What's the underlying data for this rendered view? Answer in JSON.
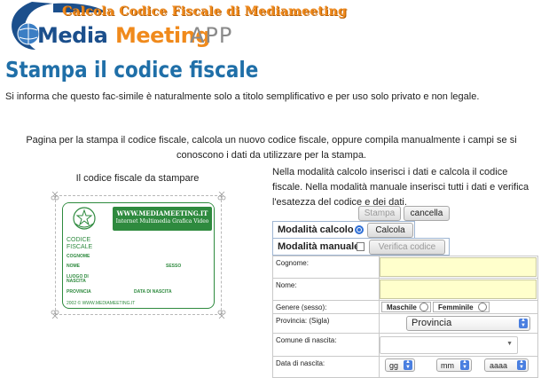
{
  "banner": {
    "title": "Calcola Codice Fiscale di Mediameeting",
    "logo_media": "Media",
    "logo_meeting": "Meeting",
    "logo_app": "APP"
  },
  "page": {
    "title": "Stampa il codice fiscale",
    "intro": "Si informa che questo fac-simile è naturalmente solo a titolo semplificativo e per uso solo privato e non legale.",
    "center_text": "Pagina per la stampa il codice fiscale, calcola un nuovo codice fiscale, oppure compila manualmente i campi se si conoscono i dati da utilizzare per la stampa."
  },
  "card": {
    "caption": "Il codice fiscale da stampare",
    "site": "WWW.MEDIAMEETING.IT",
    "subtitle": "Internet Multimedia Grafica Video",
    "cf_line1": "CODICE",
    "cf_line2": "FISCALE",
    "labels": {
      "cognome": "COGNOME",
      "nome": "NOME",
      "sesso": "SESSO",
      "luogo1": "LUOGO DI",
      "luogo2": "NASCITA",
      "provincia": "PROVINCIA",
      "data": "DATA DI NASCITA"
    },
    "footer": "2002 © WWW.MEDIAMEETING.IT",
    "colors": {
      "green": "#2e8a3e"
    }
  },
  "right": {
    "text": "Nella modalità calcolo inserisci i dati e calcola il codice fiscale. Nella modalità manuale inserisci tutti i dati e verifica l'esatezza del codice e dei dati.",
    "stampa_label": "Stampa",
    "cancella_label": "cancella",
    "mode_calcolo_label": "Modalità calcolo",
    "calcola_label": "Calcola",
    "mode_manuale_label": "Modalità manuale",
    "verifica_label": "Verifica codice"
  },
  "form": {
    "cognome_label": "Cognome:",
    "nome_label": "Nome:",
    "genere_label": "Genere (sesso):",
    "maschile_label": "Maschile",
    "femminile_label": "Femminile",
    "provincia_label": "Provincia: (Sigla)",
    "provincia_value": "Provincia",
    "comune_label": "Comune di nascita:",
    "data_label": "Data di nascita:",
    "gg_value": "gg",
    "mm_value": "mm",
    "aaaa_value": "aaaa"
  },
  "colors": {
    "title_blue": "#1f6fa8",
    "logo_orange": "#f08a1c",
    "logo_blue": "#1b4f8c",
    "input_yellow": "#ffffcc"
  }
}
